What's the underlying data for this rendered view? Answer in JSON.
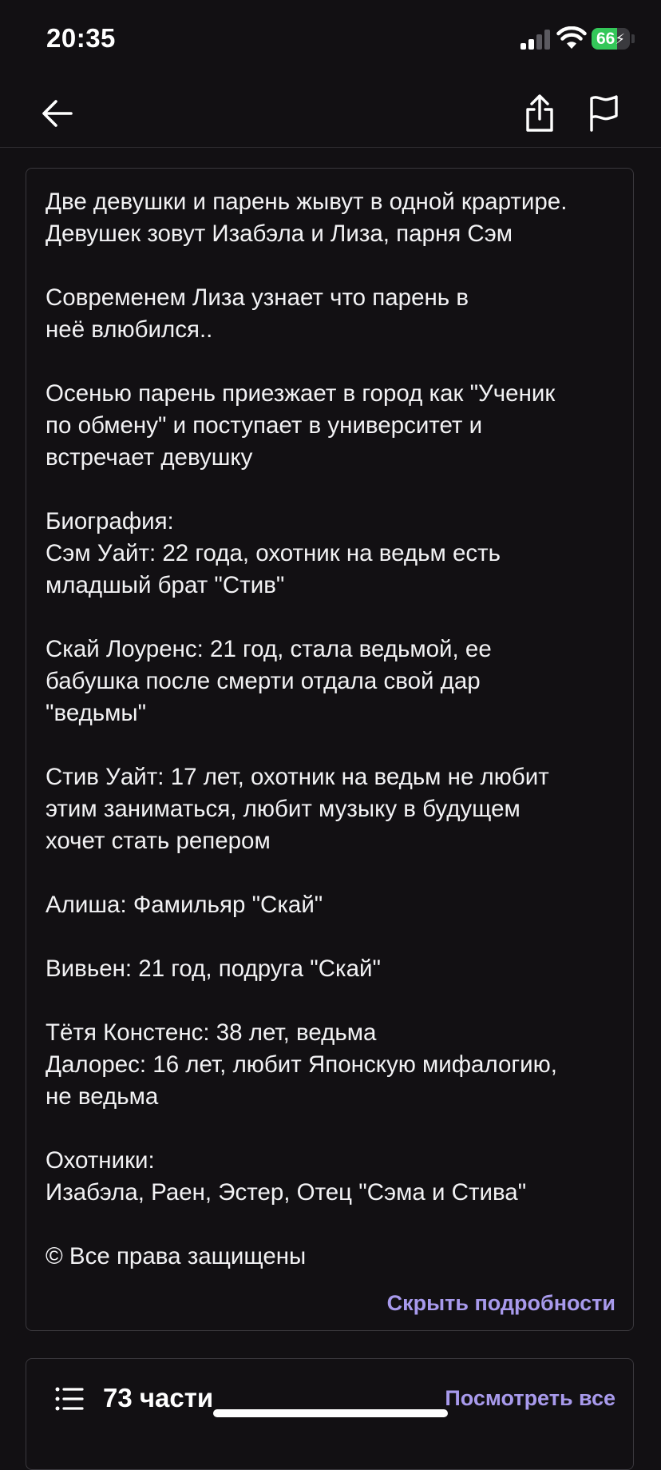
{
  "status_bar": {
    "time": "20:35",
    "battery": "66",
    "battery_level": 0.66
  },
  "nav": {
    "back_icon": "arrow-left-icon",
    "share_icon": "share-icon",
    "report_icon": "flag-icon"
  },
  "description": {
    "text": "Две девушки и парень жывут в одной крартире.\nДевушек зовут Изабэла и Лиза, парня Сэм\n\nСовременем Лиза узнает что парень в\nнеё влюбился..\n\nОсенью парень приезжает в город как \"Ученик\nпо обмену\" и поступает в университет и\nвстречает девушку\n\nБиография:\nСэм Уайт: 22 года, охотник на ведьм есть\nмладшый брат \"Стив\"\n\nСкай Лоуренс: 21 год, стала ведьмой, ее\nбабушка после смерти отдала свой дар\n\"ведьмы\"\n\nСтив Уайт: 17 лет, охотник на ведьм не любит\nэтим заниматься, любит музыку в будущем\nхочет стать репером\n\nАлиша: Фамильяр \"Скай\"\n\nВивьен: 21 год, подруга \"Скай\"\n\nТётя Констенс: 38 лет, ведьма\nДалорес: 16 лет, любит Японскую мифалогию,\nне ведьма\n\nОхотники:\nИзабэла, Раен, Эстер, Отец \"Сэма и Стива\"\n\n© Все права защищены",
    "hide_label": "Скрыть подробности"
  },
  "parts": {
    "icon": "list-icon",
    "count_label": "73 части",
    "view_all_label": "Посмотреть все"
  },
  "colors": {
    "background": "#121013",
    "accent": "#a89aec",
    "battery_green": "#34c759"
  }
}
